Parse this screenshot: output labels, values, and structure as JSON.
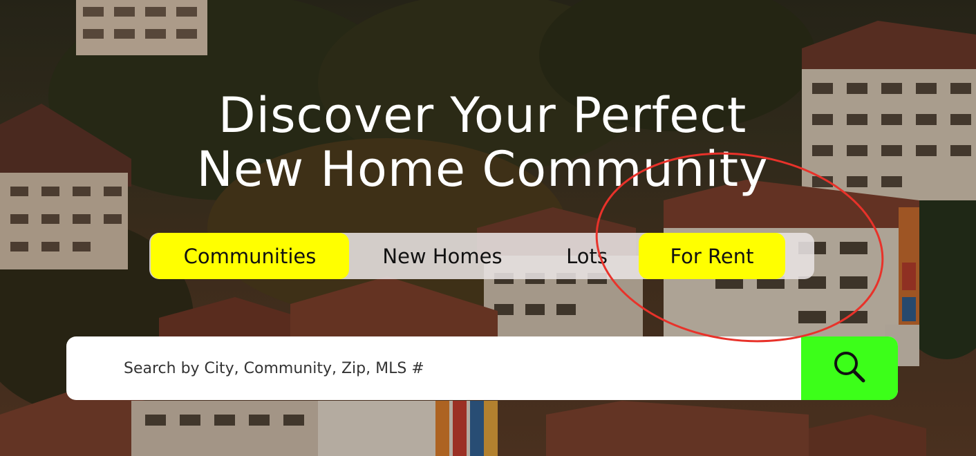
{
  "hero": {
    "title_line1": "Discover Your Perfect",
    "title_line2": "New Home Community"
  },
  "tabs": [
    {
      "label": "Communities",
      "active": true
    },
    {
      "label": "New Homes",
      "active": false
    },
    {
      "label": "Lots",
      "active": false
    },
    {
      "label": "For Rent",
      "active": true
    }
  ],
  "search": {
    "placeholder": "Search by City, Community, Zip, MLS #",
    "button_icon": "search-icon"
  },
  "colors": {
    "tab_active": "#ffff00",
    "search_button": "#3cff19",
    "annotation": "#e8322a"
  }
}
